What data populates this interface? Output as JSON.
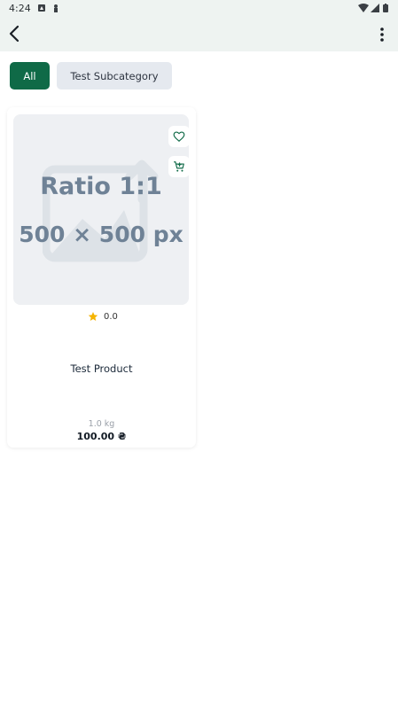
{
  "status_bar": {
    "time": "4:24"
  },
  "app_bar": {
    "back_icon": "arrow-back-icon",
    "more_icon": "more-vert-icon"
  },
  "filters": {
    "chips": [
      {
        "label": "All",
        "selected": true
      },
      {
        "label": "Test Subcategory",
        "selected": false
      }
    ]
  },
  "products": [
    {
      "placeholder_line1": "Ratio 1:1",
      "placeholder_line2": "500 × 500 px",
      "rating": "0.0",
      "name": "Test Product",
      "weight": "1.0 kg",
      "price": "100.00 ₴"
    }
  ],
  "colors": {
    "accent": "#0f6a47",
    "star": "#f5b400",
    "chip_inactive": "#e5e9ef",
    "topbar_bg": "#eef3f1"
  }
}
